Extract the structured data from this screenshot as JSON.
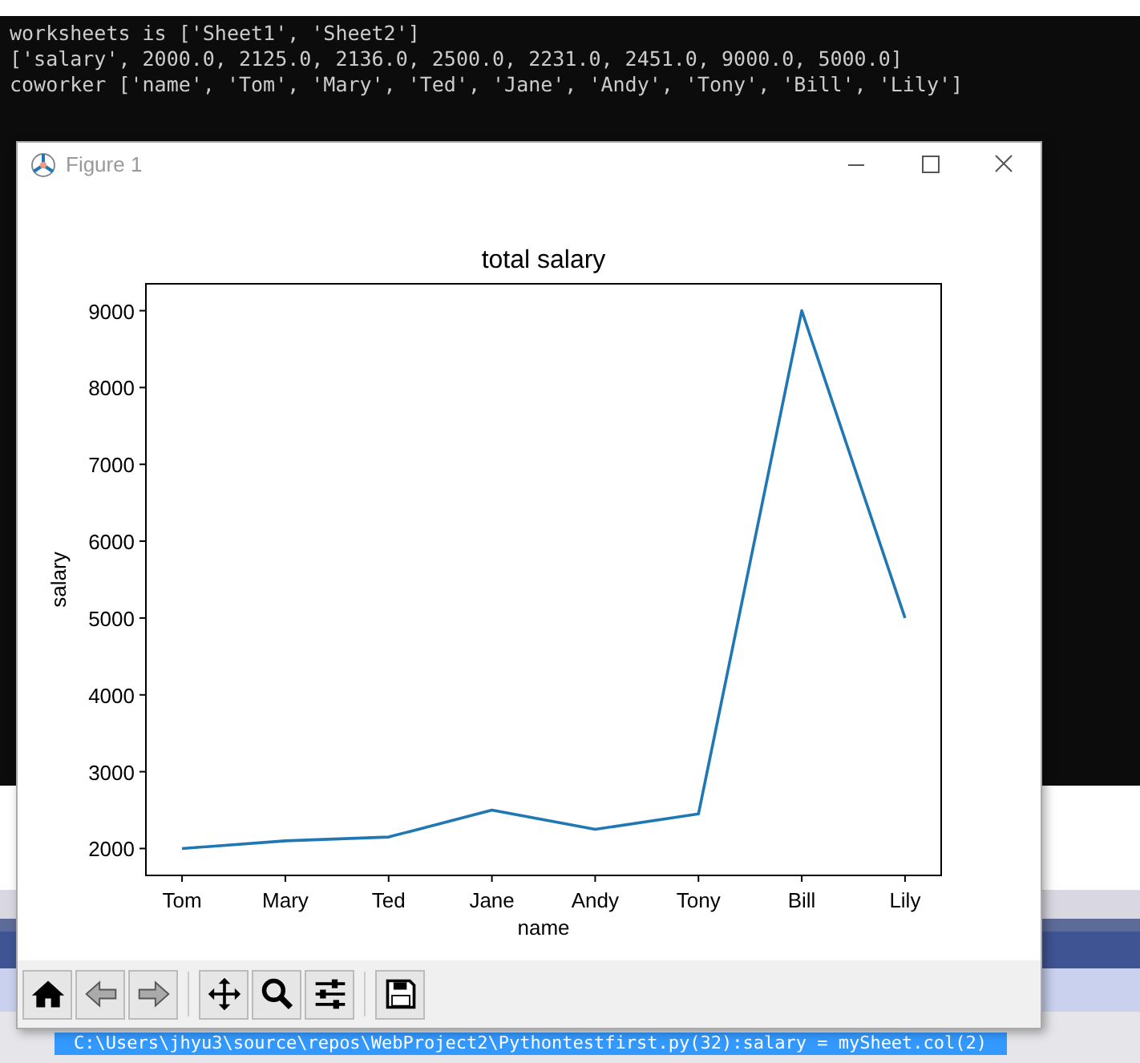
{
  "console": {
    "lines": [
      "worksheets is ['Sheet1', 'Sheet2']",
      "['salary', 2000.0, 2125.0, 2136.0, 2500.0, 2231.0, 2451.0, 9000.0, 5000.0]",
      "coworker ['name', 'Tom', 'Mary', 'Ted', 'Jane', 'Andy', 'Tony', 'Bill', 'Lily']"
    ]
  },
  "window": {
    "title": "Figure 1"
  },
  "chart_data": {
    "type": "line",
    "title": "total salary",
    "xlabel": "name",
    "ylabel": "salary",
    "categories": [
      "Tom",
      "Mary",
      "Ted",
      "Jane",
      "Andy",
      "Tony",
      "Bill",
      "Lily"
    ],
    "series": [
      {
        "color": "#1f77b4",
        "values": [
          2000,
          2100,
          2150,
          2500,
          2250,
          2450,
          9000,
          5000
        ]
      }
    ],
    "ylim": [
      1650,
      9350
    ],
    "yticks": [
      2000,
      3000,
      4000,
      5000,
      6000,
      7000,
      8000,
      9000
    ]
  },
  "toolbar": [
    {
      "kind": "home"
    },
    {
      "kind": "back"
    },
    {
      "kind": "forward"
    },
    {
      "kind": "separator"
    },
    {
      "kind": "pan"
    },
    {
      "kind": "zoom"
    },
    {
      "kind": "configure"
    },
    {
      "kind": "separator"
    },
    {
      "kind": "save"
    }
  ],
  "output": {
    "selected_line": "C:\\Users\\jhyu3\\source\\repos\\WebProject2\\Pythontestfirst.py(32):salary = mySheet.col(2)"
  }
}
